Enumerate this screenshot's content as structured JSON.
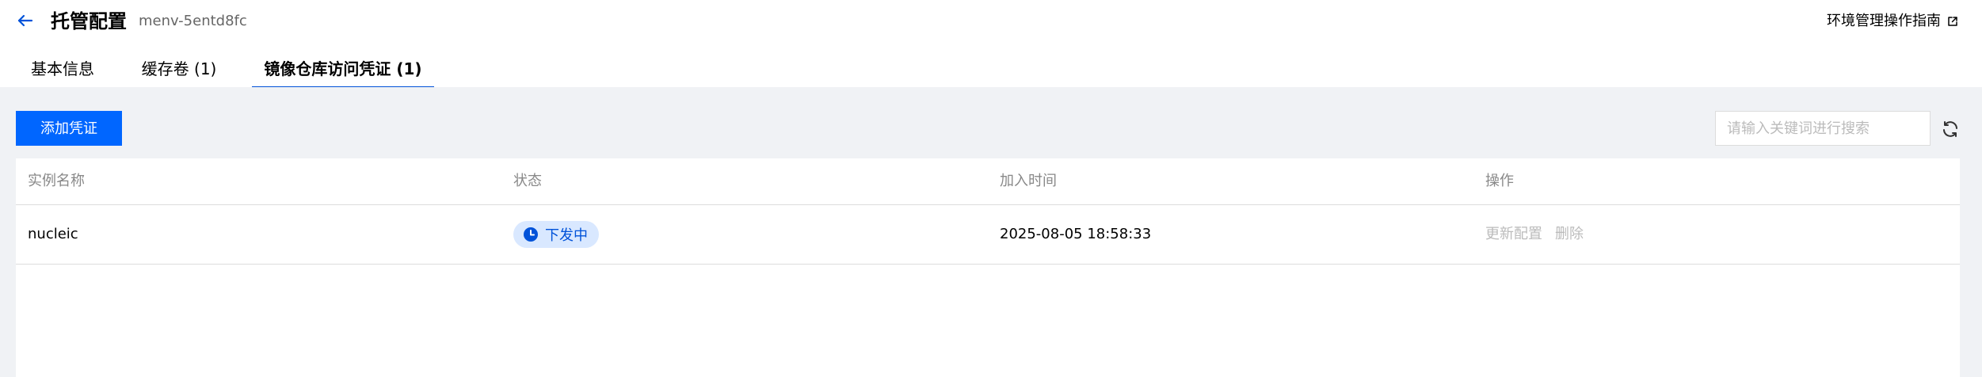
{
  "header": {
    "back_icon": "arrow-left-icon",
    "title": "托管配置",
    "subtitle": "menv-5entd8fc",
    "guide_label": "环境管理操作指南",
    "guide_icon": "external-link-icon",
    "accent_color": "#0052d9"
  },
  "tabs": [
    {
      "label": "基本信息",
      "active": false
    },
    {
      "label": "缓存卷 (1)",
      "active": false
    },
    {
      "label": "镜像仓库访问凭证 (1)",
      "active": true
    }
  ],
  "toolbar": {
    "add_label": "添加凭证",
    "search_placeholder": "请输入关键词进行搜索",
    "refresh_icon": "refresh-icon",
    "primary_color": "#0066ff"
  },
  "table": {
    "columns": [
      "实例名称",
      "状态",
      "加入时间",
      "操作"
    ],
    "rows": [
      {
        "name": "nucleic",
        "status": "下发中",
        "status_icon": "clock-icon",
        "joined": "2025-08-05 18:58:33",
        "actions": [
          "更新配置",
          "删除"
        ]
      }
    ]
  }
}
